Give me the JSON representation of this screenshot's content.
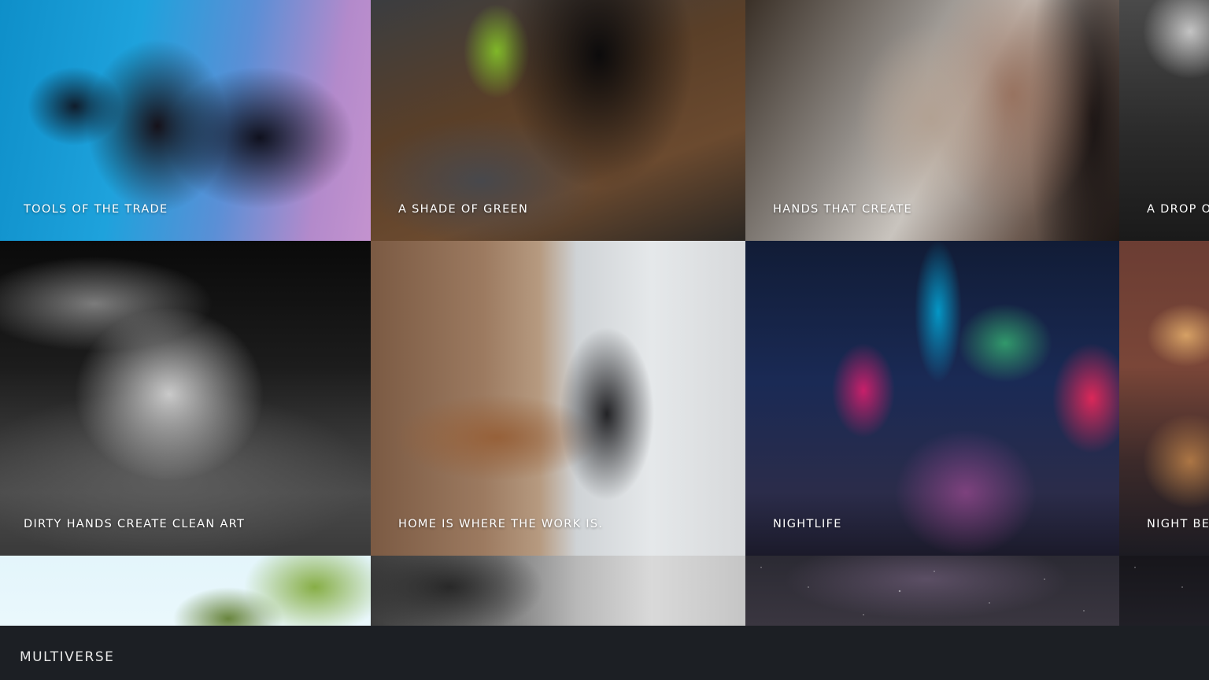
{
  "gallery": {
    "tiles": [
      {
        "caption": "TOOLS OF THE TRADE"
      },
      {
        "caption": "A SHADE OF GREEN"
      },
      {
        "caption": "HANDS THAT CREATE"
      },
      {
        "caption": "A DROP OF"
      },
      {
        "caption": "DIRTY HANDS CREATE CLEAN ART"
      },
      {
        "caption": "HOME IS WHERE THE WORK IS."
      },
      {
        "caption": "NIGHTLIFE"
      },
      {
        "caption": "NIGHT BEA"
      }
    ]
  },
  "footer": {
    "brand": "MULTIVERSE"
  },
  "colors": {
    "footer_bg": "#1c1f24",
    "caption_text": "#ffffff",
    "brand_text": "#e8e8e8"
  }
}
